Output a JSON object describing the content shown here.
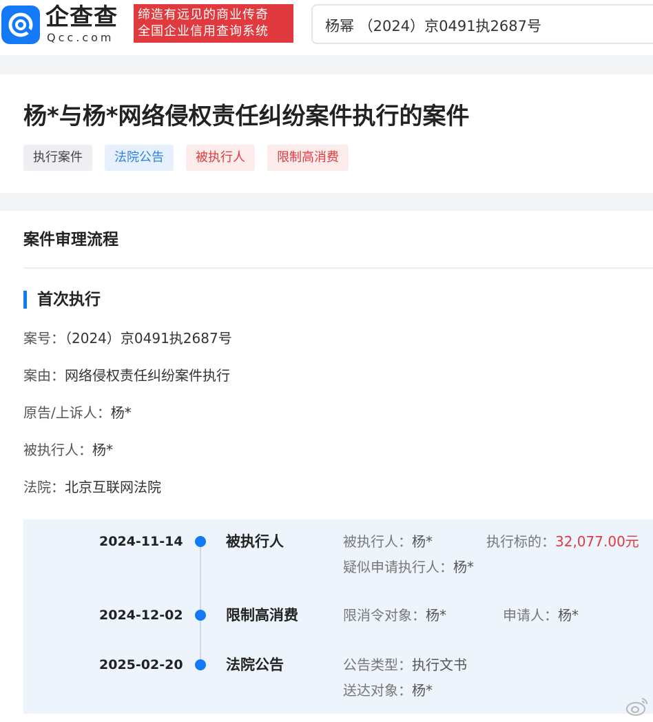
{
  "brand": {
    "name_cn": "企查查",
    "name_en": "Qcc.com",
    "slogan_line1": "缔造有远见的商业传奇",
    "slogan_line2": "全国企业信用查询系统"
  },
  "search": {
    "query": "杨幂 （2024）京0491执2687号"
  },
  "case": {
    "title": "杨*与杨*网络侵权责任纠纷案件执行的案件",
    "tags": [
      "执行案件",
      "法院公告",
      "被执行人",
      "限制高消费"
    ]
  },
  "process": {
    "section_title": "案件审理流程",
    "subtitle": "首次执行",
    "fields": [
      {
        "label": "案号：",
        "value": "（2024）京0491执2687号"
      },
      {
        "label": "案由：",
        "value": "网络侵权责任纠纷案件执行"
      },
      {
        "label": "原告/上诉人：",
        "value": "杨*"
      },
      {
        "label": "被执行人：",
        "value": "杨*"
      },
      {
        "label": "法院：",
        "value": "北京互联网法院"
      }
    ]
  },
  "timeline": [
    {
      "date": "2024-11-14",
      "type": "被执行人",
      "details": [
        {
          "label": "被执行人：",
          "value": "杨*"
        },
        {
          "label": "执行标的：",
          "value": "32,077.00元"
        },
        {
          "label": "疑似申请执行人：",
          "value": "杨*"
        }
      ]
    },
    {
      "date": "2024-12-02",
      "type": "限制高消费",
      "details": [
        {
          "label": "限消令对象：",
          "value": "杨*"
        },
        {
          "label": "申请人：",
          "value": "杨*"
        }
      ]
    },
    {
      "date": "2025-02-20",
      "type": "法院公告",
      "details": [
        {
          "label": "公告类型：",
          "value": "执行文书"
        },
        {
          "label": "送达对象：",
          "value": "杨*"
        }
      ]
    }
  ],
  "colors": {
    "brand_blue": "#1479f5",
    "brand_red": "#e0393e",
    "tag_blue_text": "#2f7ee8",
    "timeline_bg": "#eef4fb"
  },
  "icons": [
    "qcc-logo-icon",
    "weibo-watermark-icon"
  ]
}
